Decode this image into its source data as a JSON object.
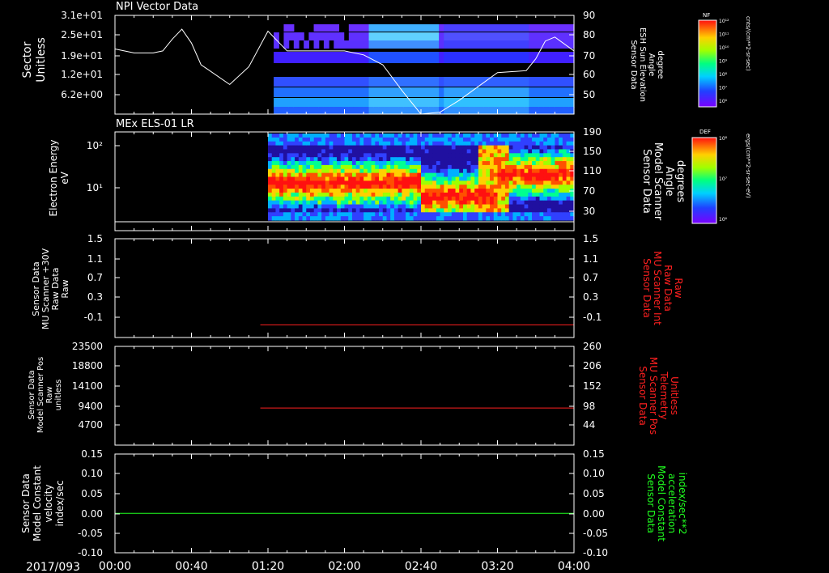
{
  "date_label": "2017/093",
  "time_ticks": [
    "00:00",
    "00:40",
    "01:20",
    "02:00",
    "02:40",
    "03:20",
    "04:00"
  ],
  "colors": {
    "red": "#ff2020",
    "green": "#20ff20",
    "white": "#ffffff"
  },
  "chart_data": [
    {
      "type": "heatmap",
      "title": "NPI Vector Data",
      "ylabel": "Sector Unitless",
      "yticks": [
        "3.1e+01",
        "2.5e+01",
        "1.9e+01",
        "1.2e+01",
        "6.2e+00"
      ],
      "right_ylabel": [
        "Sensor Data",
        "ESH Sun Elevation",
        "Angle",
        "degree"
      ],
      "right_yticks": [
        "90",
        "80",
        "70",
        "60",
        "50"
      ],
      "colorbar": {
        "label": "NF",
        "units": "cnts/(cm**2-sr-sec)",
        "ticks": [
          "10¹²",
          "10¹¹",
          "10¹⁰",
          "10⁹",
          "10⁸",
          "10⁷",
          "10⁶"
        ]
      },
      "overlay_line": {
        "x": [
          "00:00",
          "00:10",
          "00:20",
          "00:25",
          "00:30",
          "00:35",
          "00:40",
          "00:45",
          "01:00",
          "01:10",
          "01:20",
          "01:30",
          "02:00",
          "02:10",
          "02:20",
          "02:30",
          "02:40",
          "02:50",
          "03:00",
          "03:10",
          "03:20",
          "03:35",
          "03:40",
          "03:45",
          "03:50",
          "04:00"
        ],
        "y": [
          73,
          71,
          71,
          72,
          78,
          83,
          76,
          65,
          55,
          64,
          82,
          72,
          72,
          70,
          65,
          52,
          40,
          41,
          47,
          54,
          61,
          62,
          68,
          77,
          79,
          72
        ]
      }
    },
    {
      "type": "heatmap",
      "title": "MEx ELS-01 LR",
      "ylabel": "Electron Energy eV",
      "yticks": [
        "10²",
        "10¹"
      ],
      "right_ylabel": [
        "Sensor Data",
        "Model Scanner",
        "Angle",
        "degrees"
      ],
      "right_yticks": [
        "190",
        "150",
        "110",
        "70",
        "30"
      ],
      "colorbar": {
        "label": "DEF",
        "units": "ergs/(cm**2-sr-sec-eV)",
        "ticks": [
          "10⁸",
          "10⁷",
          "10⁶"
        ]
      }
    },
    {
      "type": "line",
      "ylabel": "Sensor Data MU Scanner +30V Raw Data Raw",
      "yticks": [
        "1.5",
        "1.1",
        "0.7",
        "0.3",
        "-0.1"
      ],
      "right_yticks": [
        "1.5",
        "1.1",
        "0.7",
        "0.3",
        "-0.1"
      ],
      "right_ylabel": [
        "Sensor Data",
        "MU Scanner Int",
        "Raw Data",
        "Raw"
      ],
      "series": [
        {
          "x": [
            "01:16",
            "04:00"
          ],
          "values": [
            -0.07,
            -0.07
          ]
        }
      ]
    },
    {
      "type": "line",
      "ylabel": "Sensor Data Model Scanner Pos Raw unitless",
      "yticks": [
        "23500",
        "18800",
        "14100",
        "9400",
        "4700"
      ],
      "right_yticks": [
        "260",
        "206",
        "152",
        "98",
        "44"
      ],
      "right_ylabel": [
        "Sensor Data",
        "MU Scanner Pos",
        "Telemetry",
        "Unitless"
      ],
      "series": [
        {
          "x": [
            "01:16",
            "04:00"
          ],
          "values": [
            8200,
            8200
          ]
        }
      ]
    },
    {
      "type": "line",
      "ylabel": "Sensor Data Model Constant velocity index/sec",
      "yticks": [
        "0.15",
        "0.10",
        "0.05",
        "0.00",
        "-0.05",
        "-0.10"
      ],
      "right_yticks": [
        "0.15",
        "0.10",
        "0.05",
        "0.00",
        "-0.05",
        "-0.10"
      ],
      "right_ylabel": [
        "Sensor Data",
        "Model Constant",
        "acceleration",
        "index/sec**2"
      ],
      "series": [
        {
          "x": [
            "00:00",
            "04:00"
          ],
          "values": [
            0.0,
            0.0
          ]
        }
      ]
    }
  ]
}
